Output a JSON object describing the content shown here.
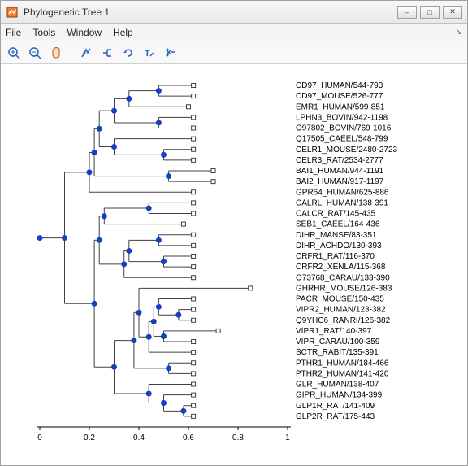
{
  "window": {
    "title": "Phylogenetic Tree 1",
    "min_label": "–",
    "max_label": "□",
    "close_label": "✕"
  },
  "menu": {
    "file": "File",
    "tools": "Tools",
    "window": "Window",
    "help": "Help"
  },
  "toolbar": {
    "zoom_in": "zoom-in-icon",
    "zoom_out": "zoom-out-icon",
    "pan": "pan-icon",
    "inspect": "inspect-icon",
    "collapse": "collapse-icon",
    "rotate": "rotate-icon",
    "rename": "rename-icon",
    "prune": "prune-icon"
  },
  "chart_data": {
    "type": "dendrogram",
    "xlabel": "",
    "ylabel": "",
    "xlim": [
      0,
      1
    ],
    "xticks": [
      0,
      0.2,
      0.4,
      0.6,
      0.8,
      1
    ],
    "leaves": [
      {
        "label": "CD97_HUMAN/544-793",
        "x": 0.62
      },
      {
        "label": "CD97_MOUSE/526-777",
        "x": 0.62
      },
      {
        "label": "EMR1_HUMAN/599-851",
        "x": 0.6
      },
      {
        "label": "LPHN3_BOVIN/942-1198",
        "x": 0.62
      },
      {
        "label": "O97802_BOVIN/769-1016",
        "x": 0.62
      },
      {
        "label": "Q17505_CAEEL/548-799",
        "x": 0.62
      },
      {
        "label": "CELR1_MOUSE/2480-2723",
        "x": 0.62
      },
      {
        "label": "CELR3_RAT/2534-2777",
        "x": 0.62
      },
      {
        "label": "BAI1_HUMAN/944-1191",
        "x": 0.7
      },
      {
        "label": "BAI2_HUMAN/917-1197",
        "x": 0.7
      },
      {
        "label": "GPR64_HUMAN/625-886",
        "x": 0.62
      },
      {
        "label": "CALRL_HUMAN/138-391",
        "x": 0.62
      },
      {
        "label": "CALCR_RAT/145-435",
        "x": 0.62
      },
      {
        "label": "SEB1_CAEEL/164-436",
        "x": 0.58
      },
      {
        "label": "DIHR_MANSE/83-351",
        "x": 0.62
      },
      {
        "label": "DIHR_ACHDO/130-393",
        "x": 0.62
      },
      {
        "label": "CRFR1_RAT/116-370",
        "x": 0.62
      },
      {
        "label": "CRFR2_XENLA/115-368",
        "x": 0.62
      },
      {
        "label": "O73768_CARAU/133-390",
        "x": 0.62
      },
      {
        "label": "GHRHR_MOUSE/126-383",
        "x": 0.85
      },
      {
        "label": "PACR_MOUSE/150-435",
        "x": 0.62
      },
      {
        "label": "VIPR2_HUMAN/123-382",
        "x": 0.62
      },
      {
        "label": "Q9YHC6_RANRI/126-382",
        "x": 0.62
      },
      {
        "label": "VIPR1_RAT/140-397",
        "x": 0.72
      },
      {
        "label": "VIPR_CARAU/100-359",
        "x": 0.62
      },
      {
        "label": "SCTR_RABIT/135-391",
        "x": 0.62
      },
      {
        "label": "PTHR1_HUMAN/184-466",
        "x": 0.62
      },
      {
        "label": "PTHR2_HUMAN/141-420",
        "x": 0.62
      },
      {
        "label": "GLR_HUMAN/138-407",
        "x": 0.62
      },
      {
        "label": "GIPR_HUMAN/134-399",
        "x": 0.62
      },
      {
        "label": "GLP1R_RAT/141-409",
        "x": 0.62
      },
      {
        "label": "GLP2R_RAT/175-443",
        "x": 0.62
      }
    ],
    "internal_nodes": [
      {
        "x": 0.48,
        "children": [
          0,
          1
        ]
      },
      {
        "x": 0.36,
        "children_nodes": [
          "n0",
          2
        ]
      },
      {
        "x": 0.48,
        "children": [
          3,
          4
        ]
      },
      {
        "x": 0.3,
        "children_nodes": [
          "n1",
          "n2"
        ]
      },
      {
        "x": 0.5,
        "children": [
          6,
          7
        ]
      },
      {
        "x": 0.3,
        "children_nodes": [
          5,
          "n4"
        ]
      },
      {
        "x": 0.52,
        "children": [
          8,
          9
        ]
      },
      {
        "x": 0.24,
        "children_nodes": [
          "n3",
          "n5"
        ]
      },
      {
        "x": 0.22,
        "children_nodes": [
          "n7",
          "n6"
        ]
      },
      {
        "x": 0.2,
        "children_nodes": [
          "n8",
          10
        ]
      },
      {
        "x": 0.44,
        "children": [
          11,
          12
        ]
      },
      {
        "x": 0.48,
        "children": [
          14,
          15
        ]
      },
      {
        "x": 0.5,
        "children": [
          16,
          17
        ]
      },
      {
        "x": 0.36,
        "children_nodes": [
          "n11",
          "n12"
        ]
      },
      {
        "x": 0.34,
        "children_nodes": [
          "n13",
          18
        ]
      },
      {
        "x": 0.26,
        "children_nodes": [
          "n10",
          13
        ]
      },
      {
        "x": 0.24,
        "children_nodes": [
          "n15",
          "n14"
        ]
      },
      {
        "x": 0.56,
        "children": [
          21,
          22
        ]
      },
      {
        "x": 0.48,
        "children_nodes": [
          20,
          "n17"
        ]
      },
      {
        "x": 0.5,
        "children_nodes": [
          23,
          24
        ]
      },
      {
        "x": 0.46,
        "children_nodes": [
          "n18",
          "n19"
        ]
      },
      {
        "x": 0.44,
        "children_nodes": [
          "n20",
          25
        ]
      },
      {
        "x": 0.4,
        "children_nodes": [
          19,
          "n21"
        ]
      },
      {
        "x": 0.52,
        "children": [
          26,
          27
        ]
      },
      {
        "x": 0.38,
        "children_nodes": [
          "n22",
          "n23"
        ]
      },
      {
        "x": 0.58,
        "children": [
          30,
          31
        ]
      },
      {
        "x": 0.5,
        "children_nodes": [
          29,
          "n25"
        ]
      },
      {
        "x": 0.44,
        "children_nodes": [
          28,
          "n26"
        ]
      },
      {
        "x": 0.3,
        "children_nodes": [
          "n24",
          "n27"
        ]
      },
      {
        "x": 0.22,
        "children_nodes": [
          "n16",
          "n28"
        ]
      },
      {
        "x": 0.1,
        "children_nodes": [
          "n9",
          "n29"
        ]
      },
      {
        "x": 0.0,
        "children_nodes": [
          "n30"
        ]
      }
    ]
  }
}
